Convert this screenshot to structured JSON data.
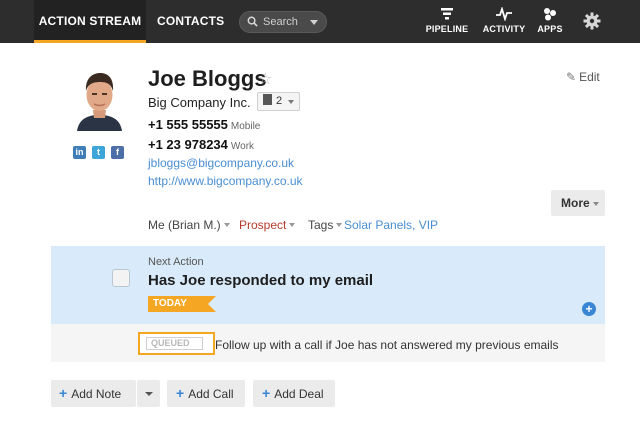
{
  "nav": {
    "tabs": [
      "ACTION STREAM",
      "CONTACTS"
    ],
    "search_placeholder": "Search",
    "icons": [
      {
        "name": "pipeline-icon",
        "label": "PIPELINE"
      },
      {
        "name": "activity-icon",
        "label": "ACTIVITY"
      },
      {
        "name": "apps-icon",
        "label": "APPS"
      },
      {
        "name": "gear-icon",
        "label": ""
      }
    ]
  },
  "contact": {
    "name": "Joe Bloggs",
    "star": "☆",
    "edit_label": "Edit",
    "company": "Big Company Inc.",
    "company_count": "2",
    "phones": [
      {
        "number": "+1 555 55555",
        "type": "Mobile"
      },
      {
        "number": "+1 23 978234",
        "type": "Work"
      }
    ],
    "email": "jbloggs@bigcompany.co.uk",
    "website": "http://www.bigcompany.co.uk",
    "social": {
      "linkedin": "in",
      "twitter": "t",
      "facebook": "f"
    },
    "more_label": "More",
    "owner": "Me (Brian M.)",
    "status": "Prospect",
    "tags_label": "Tags",
    "tags": "Solar Panels, VIP"
  },
  "next_action": {
    "label": "Next Action",
    "title": "Has Joe responded to my email",
    "badge": "TODAY"
  },
  "queued": {
    "badge": "QUEUED",
    "text": "Follow up with a call if Joe has not answered my previous emails"
  },
  "buttons": {
    "add_note": "Add Note",
    "add_call": "Add Call",
    "add_deal": "Add Deal"
  },
  "colors": {
    "accent": "#f5a623",
    "link": "#4a8ed2",
    "prospect": "#b53a2c",
    "next_action_bg": "#d9ebfa"
  }
}
